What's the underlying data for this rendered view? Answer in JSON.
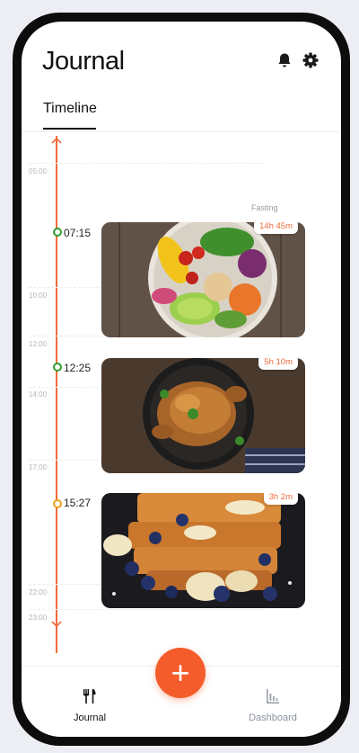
{
  "app": {
    "title": "Journal"
  },
  "header": {
    "icons": {
      "notifications": "bell-icon",
      "settings": "gear-icon"
    }
  },
  "tabs": [
    {
      "label": "Timeline",
      "active": true
    }
  ],
  "timeline": {
    "ticks": [
      "05:00",
      "10:00",
      "12:00",
      "14:00",
      "17:00",
      "22:00",
      "23:00"
    ],
    "fasting_label": "Fasting",
    "meals": [
      {
        "time": "07:15",
        "duration": "14h 45m",
        "photo": "salad-bowl",
        "dot_color": "#2e9f2e"
      },
      {
        "time": "12:25",
        "duration": "5h 10m",
        "photo": "roast-chicken",
        "dot_color": "#2e9f2e"
      },
      {
        "time": "15:27",
        "duration": "3h 2m",
        "photo": "french-toast",
        "dot_color": "#f3a21b"
      }
    ],
    "accent": "#f06a3a"
  },
  "bottom_nav": {
    "journal_label": "Journal",
    "dashboard_label": "Dashboard",
    "add_icon": "plus-icon",
    "active": "Journal",
    "fab_color": "#f45c2c"
  }
}
